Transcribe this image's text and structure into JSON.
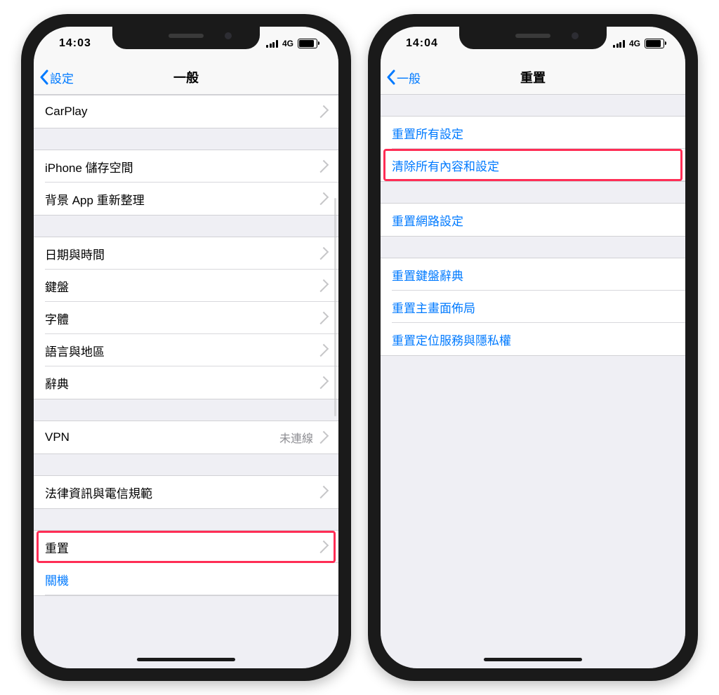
{
  "page_type": "two iPhone screenshots side-by-side showing iOS Settings > General and Settings > General > Reset in Traditional Chinese, with highlighted rows",
  "left": {
    "status": {
      "time": "14:03",
      "network": "4G"
    },
    "nav": {
      "back_label": "設定",
      "title": "一般"
    },
    "groups": [
      {
        "rows": [
          {
            "label": "CarPlay"
          }
        ]
      },
      {
        "rows": [
          {
            "label": "iPhone 儲存空間"
          },
          {
            "label": "背景 App 重新整理"
          }
        ]
      },
      {
        "rows": [
          {
            "label": "日期與時間"
          },
          {
            "label": "鍵盤"
          },
          {
            "label": "字體"
          },
          {
            "label": "語言與地區"
          },
          {
            "label": "辭典"
          }
        ]
      },
      {
        "rows": [
          {
            "label": "VPN",
            "detail": "未連線"
          }
        ]
      },
      {
        "rows": [
          {
            "label": "法律資訊與電信規範"
          }
        ]
      },
      {
        "rows": [
          {
            "label": "重置",
            "highlighted": true
          },
          {
            "label": "關機",
            "blue_link": true,
            "no_chevron": true
          }
        ]
      }
    ]
  },
  "right": {
    "status": {
      "time": "14:04",
      "network": "4G"
    },
    "nav": {
      "back_label": "一般",
      "title": "重置"
    },
    "groups": [
      {
        "rows": [
          {
            "label": "重置所有設定"
          },
          {
            "label": "清除所有內容和設定",
            "highlighted": true
          }
        ]
      },
      {
        "rows": [
          {
            "label": "重置網路設定"
          }
        ]
      },
      {
        "rows": [
          {
            "label": "重置鍵盤辭典"
          },
          {
            "label": "重置主畫面佈局"
          },
          {
            "label": "重置定位服務與隱私權"
          }
        ]
      }
    ]
  }
}
